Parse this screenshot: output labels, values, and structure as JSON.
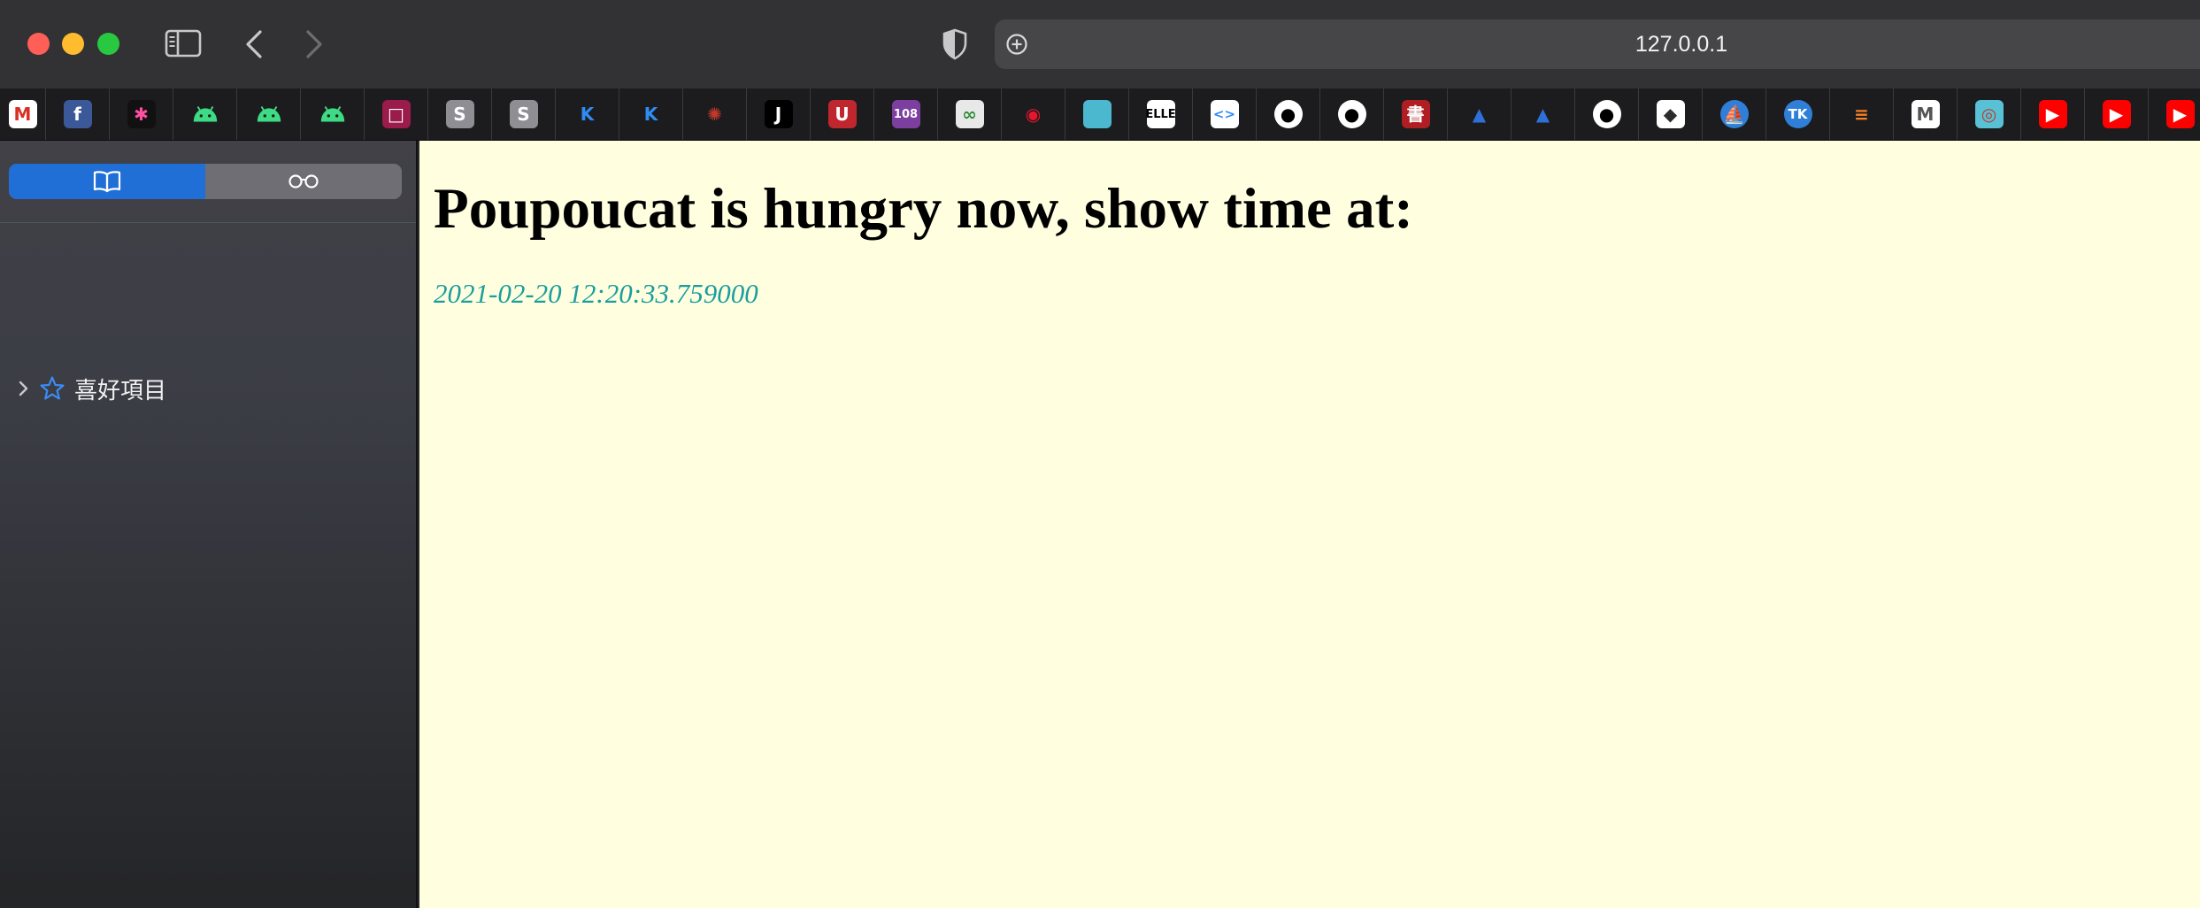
{
  "browser": {
    "address": "127.0.0.1"
  },
  "favorites": [
    {
      "name": "gmail-icon",
      "glyph": "M",
      "bg": "#ffffff",
      "fg": "#d93025"
    },
    {
      "name": "facebook-icon",
      "glyph": "f",
      "bg": "#3b5998",
      "fg": "#ffffff"
    },
    {
      "name": "photos-pinwheel-icon",
      "glyph": "✱",
      "bg": "#111111",
      "fg": "#ff4fa3"
    },
    {
      "name": "android-icon",
      "glyph": "",
      "bg": "#1c1c1e",
      "fg": "#3ddc84"
    },
    {
      "name": "android-icon",
      "glyph": "",
      "bg": "#1c1c1e",
      "fg": "#3ddc84"
    },
    {
      "name": "android-icon",
      "glyph": "",
      "bg": "#1c1c1e",
      "fg": "#3ddc84"
    },
    {
      "name": "square-red-icon",
      "glyph": "□",
      "bg": "#9b1b4a",
      "fg": "#ffffff"
    },
    {
      "name": "s-icon",
      "glyph": "S",
      "bg": "#8e8e93",
      "fg": "#ffffff"
    },
    {
      "name": "s-icon",
      "glyph": "S",
      "bg": "#8e8e93",
      "fg": "#ffffff"
    },
    {
      "name": "kotlin-icon",
      "glyph": "K",
      "bg": "#1c1c1e",
      "fg": "#2f8cf5"
    },
    {
      "name": "kotlin-icon",
      "glyph": "K",
      "bg": "#1c1c1e",
      "fg": "#2f8cf5"
    },
    {
      "name": "bug-icon",
      "glyph": "✺",
      "bg": "#1c1c1e",
      "fg": "#c0392b"
    },
    {
      "name": "j-icon",
      "glyph": "J",
      "bg": "#000000",
      "fg": "#ffffff"
    },
    {
      "name": "red-circle-u-icon",
      "glyph": "U",
      "bg": "#c0262d",
      "fg": "#ffffff"
    },
    {
      "name": "108-icon",
      "glyph": "108",
      "bg": "#7c3fa0",
      "fg": "#ffffff"
    },
    {
      "name": "green-loop-icon",
      "glyph": "∞",
      "bg": "#e8e8e8",
      "fg": "#2e8b3a"
    },
    {
      "name": "weibo-icon",
      "glyph": "◉",
      "bg": "#1c1c1e",
      "fg": "#e6162d"
    },
    {
      "name": "teal-square-icon",
      "glyph": "",
      "bg": "#4cb8d0",
      "fg": "#ffffff"
    },
    {
      "name": "elle-icon",
      "glyph": "ELLE",
      "bg": "#ffffff",
      "fg": "#000000"
    },
    {
      "name": "code-brackets-icon",
      "glyph": "<>",
      "bg": "#ffffff",
      "fg": "#2f8cf5"
    },
    {
      "name": "github-icon",
      "glyph": "●",
      "bg": "#ffffff",
      "fg": "#000000"
    },
    {
      "name": "github-icon",
      "glyph": "●",
      "bg": "#ffffff",
      "fg": "#000000"
    },
    {
      "name": "red-seal-icon",
      "glyph": "書",
      "bg": "#b01e23",
      "fg": "#ffffff"
    },
    {
      "name": "graduation-cap-icon",
      "glyph": "▲",
      "bg": "#1c1c1e",
      "fg": "#2f6fd8"
    },
    {
      "name": "graduation-cap-icon",
      "glyph": "▲",
      "bg": "#1c1c1e",
      "fg": "#2f6fd8"
    },
    {
      "name": "github-icon",
      "glyph": "●",
      "bg": "#ffffff",
      "fg": "#000000"
    },
    {
      "name": "diamond-logo-icon",
      "glyph": "◆",
      "bg": "#ffffff",
      "fg": "#2b2b2b"
    },
    {
      "name": "blue-ship-icon",
      "glyph": "⛵",
      "bg": "#2f7fd8",
      "fg": "#ffffff"
    },
    {
      "name": "tk-globe-icon",
      "glyph": "TK",
      "bg": "#2f7fd8",
      "fg": "#ffffff"
    },
    {
      "name": "stackoverflow-icon",
      "glyph": "≡",
      "bg": "#1c1c1e",
      "fg": "#f48024"
    },
    {
      "name": "m-icon",
      "glyph": "M",
      "bg": "#ffffff",
      "fg": "#555555"
    },
    {
      "name": "colorful-badge-icon",
      "glyph": "◎",
      "bg": "#59c1d6",
      "fg": "#c0392b"
    },
    {
      "name": "youtube-icon",
      "glyph": "▶",
      "bg": "#ff0000",
      "fg": "#ffffff"
    },
    {
      "name": "youtube-icon",
      "glyph": "▶",
      "bg": "#ff0000",
      "fg": "#ffffff"
    },
    {
      "name": "youtube-icon",
      "glyph": "▶",
      "bg": "#ff0000",
      "fg": "#ffffff"
    }
  ],
  "sidebar": {
    "favorites_label": "喜好項目"
  },
  "page": {
    "heading": "Poupoucat is hungry now, show time at:",
    "timestamp": "2021-02-20 12:20:33.759000"
  }
}
